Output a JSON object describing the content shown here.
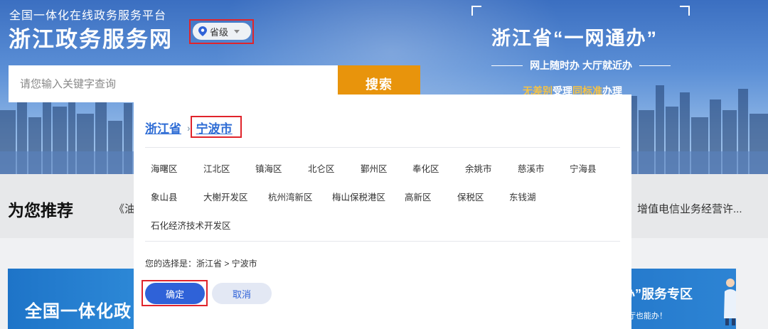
{
  "header": {
    "platform_subtitle": "全国一体化在线政务服务平台",
    "site_title": "浙江政务服务网",
    "region_selector": {
      "value": "省级",
      "icon": "location-pin-icon"
    }
  },
  "search": {
    "placeholder": "请您输入关键字查询",
    "button_label": "搜索"
  },
  "slogan": {
    "main": "浙江省“一网通办”",
    "sub": "网上随时办  大厅就近办",
    "third_highlight_1": "无差别",
    "third_text_1": "受理",
    "third_highlight_2": "同标准",
    "third_text_2": "办理"
  },
  "recommend": {
    "title": "为您推荐",
    "item_left": "《油",
    "item_right": "增值电信业务经营许..."
  },
  "cards": {
    "left_text": "全国一体化政",
    "right_title": "办”服务专区",
    "right_subtitle": "厅也能办！"
  },
  "modal": {
    "breadcrumb": {
      "province": "浙江省",
      "separator": "›",
      "city": "宁波市"
    },
    "districts": [
      "海曙区",
      "江北区",
      "镇海区",
      "北仑区",
      "鄞州区",
      "奉化区",
      "余姚市",
      "慈溪市",
      "宁海县",
      "象山县",
      "大榭开发区",
      "杭州湾新区",
      "梅山保税港区",
      "高新区",
      "保税区",
      "东钱湖",
      "石化经济技术开发区"
    ],
    "selection_text": "您的选择是：浙江省 > 宁波市",
    "confirm_label": "确定",
    "cancel_label": "取消"
  },
  "colors": {
    "accent_blue": "#2f62d8",
    "link_blue": "#2f6dd5",
    "search_orange": "#e8940c",
    "highlight_red": "#e0242b"
  }
}
